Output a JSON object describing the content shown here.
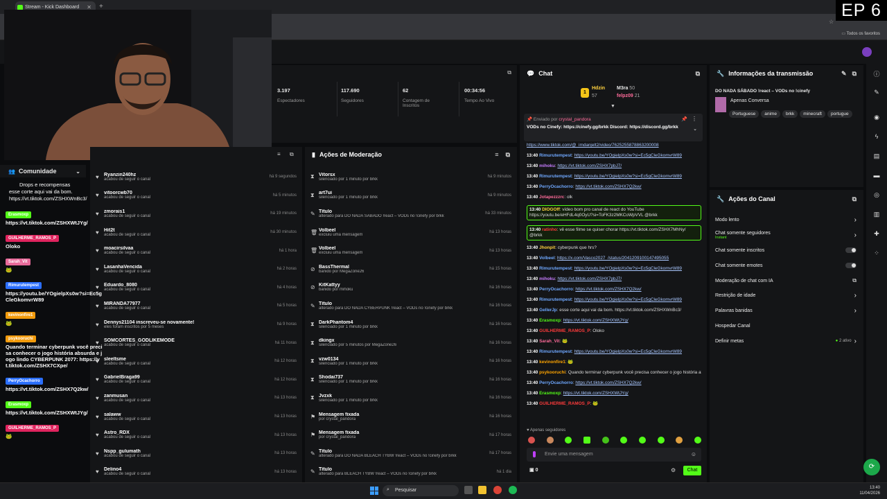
{
  "browser": {
    "tab_title": "Stream - Kick Dashboard",
    "tab_close": "✕",
    "new_tab": "+",
    "bookmarks_folder": "Todos os favoritos"
  },
  "overlay_label": "EP 6",
  "stats": [
    {
      "value": "3.197",
      "label": "Espectadores"
    },
    {
      "value": "117.690",
      "label": "Seguidores"
    },
    {
      "value": "62",
      "label": "Contagem de Inscritos"
    },
    {
      "value": "00:34:56",
      "label": "Tempo Ao Vivo"
    }
  ],
  "community": {
    "title": "Comunidade",
    "drops_text": "Drops e recompensas",
    "items": [
      {
        "name": "Ryanzin240hz",
        "action": "acabou de seguir o canal",
        "time": "há 9 segundos"
      },
      {
        "name": "vitoorcwb70",
        "action": "acabou de seguir o canal",
        "time": "há 5 minutos"
      },
      {
        "name": "zmorais1",
        "action": "acabou de seguir o canal",
        "time": "há 19 minutos"
      },
      {
        "name": "Hit2t",
        "action": "acabou de seguir o canal",
        "time": "há 30 minutos"
      },
      {
        "name": "moacirsilvaa",
        "action": "acabou de seguir o canal",
        "time": "há 1 hora"
      },
      {
        "name": "LasanhaVencida",
        "action": "acabou de seguir o canal",
        "time": "há 2 horas"
      },
      {
        "name": "Eduardo_8080",
        "action": "acabou de seguir o canal",
        "time": "há 4 horas"
      },
      {
        "name": "MIRANDA77977",
        "action": "acabou de seguir o canal",
        "time": "há 5 horas"
      },
      {
        "name": "Dennys21104 inscreveu-se novamente!",
        "action": "eles foram inscritos por 5 meses",
        "time": "há 9 horas"
      },
      {
        "name": "SOMCORTES_GODLIKEMODE",
        "action": "acabou de seguir o canal",
        "time": "há 11 horas"
      },
      {
        "name": "sleeltsme",
        "action": "acabou de seguir o canal",
        "time": "há 12 horas"
      },
      {
        "name": "GabrielBraga99",
        "action": "acabou de seguir o canal",
        "time": "há 12 horas"
      },
      {
        "name": "zanmusan",
        "action": "acabou de seguir o canal",
        "time": "há 13 horas"
      },
      {
        "name": "salaww",
        "action": "acabou de seguir o canal",
        "time": "há 13 horas"
      },
      {
        "name": "Astro_RDX",
        "action": "acabou de seguir o canal",
        "time": "há 13 horas"
      },
      {
        "name": "Nspp_gulumath",
        "action": "acabou de seguir o canal",
        "time": "há 13 horas"
      },
      {
        "name": "Delino4",
        "action": "acabou de seguir o canal",
        "time": "há 13 horas"
      }
    ]
  },
  "moderation": {
    "title": "Ações de Moderação",
    "items": [
      {
        "icon": "⧗",
        "name": "Vitorsx",
        "detail": "silenciado por 1 minuto por brkk",
        "time": "há 9 minutos"
      },
      {
        "icon": "⧗",
        "name": "art7ui",
        "detail": "silenciado por 1 minuto por brkk",
        "time": "há 9 minutos"
      },
      {
        "icon": "✎",
        "name": "Título",
        "detail": "alterado para DO NADA SÁBADO !react – VODs no !cinefy por brkk",
        "time": "há 33 minutos"
      },
      {
        "icon": "🗑",
        "name": "Volbeel",
        "detail": "excluiu uma mensagem",
        "time": "há 13 horas"
      },
      {
        "icon": "🗑",
        "name": "Volbeel",
        "detail": "excluiu uma mensagem",
        "time": "há 13 horas"
      },
      {
        "icon": "⊘",
        "name": "BassThermal",
        "detail": "banido por MegaZone26",
        "time": "há 15 horas"
      },
      {
        "icon": "⊘",
        "name": "KitKattyy",
        "detail": "banido por mihoku",
        "time": "há 16 horas"
      },
      {
        "icon": "✎",
        "name": "Título",
        "detail": "alterado para DO NADA CYBERPUNK !react – VODs no !cinefy por brkk",
        "time": "há 16 horas"
      },
      {
        "icon": "⧗",
        "name": "DarkPhantom4",
        "detail": "silenciado por 1 minuto por brkk",
        "time": "há 16 horas"
      },
      {
        "icon": "⧗",
        "name": "dkingx",
        "detail": "silenciado por 5 minutos por MegaZone26",
        "time": "há 16 horas"
      },
      {
        "icon": "⧗",
        "name": "vzw0134",
        "detail": "silenciado por 1 minuto por brkk",
        "time": "há 16 horas"
      },
      {
        "icon": "⧗",
        "name": "Shodai737",
        "detail": "silenciado por 1 minuto por brkk",
        "time": "há 16 horas"
      },
      {
        "icon": "⧗",
        "name": "Jvzxk",
        "detail": "silenciado por 1 minuto por brkk",
        "time": "há 16 horas"
      },
      {
        "icon": "⚑",
        "name": "Mensagem fixada",
        "detail": "por crystal_pandora",
        "time": "há 16 horas"
      },
      {
        "icon": "⚑",
        "name": "Mensagem fixada",
        "detail": "por crystal_pandora",
        "time": "há 17 horas"
      },
      {
        "icon": "✎",
        "name": "Título",
        "detail": "alterado para DO NADA BLEACH TYBW !react – VODs no !cinefy por brkk",
        "time": "há 17 horas"
      },
      {
        "icon": "✎",
        "name": "Título",
        "detail": "alterado para BLEACH TYBW !react – VODs no !cinefy por brkk",
        "time": "há 1 dia"
      }
    ]
  },
  "chat": {
    "title": "Chat",
    "leaders": [
      {
        "name": "Hdzin",
        "count": "57"
      },
      {
        "name": "M3ra",
        "count": "50"
      },
      {
        "name": "felpz09",
        "count": "21"
      }
    ],
    "pinned_by_label": "Enviado por",
    "pinned_user": "crystal_pandora",
    "pinned_text": "VODs no Cinefy: https://cinefy.gg/brkk Discord: https://discord.gg/brkk",
    "messages": [
      {
        "time": "",
        "user": "",
        "color": "#ddd",
        "text": "https://www.tiktok.com/@_imdanjelt2/video/7625255878863200008",
        "link": true
      },
      {
        "time": "13:40",
        "user": "Rimurutempest",
        "color": "#6fa8ff",
        "text": "https://youtu.be/YOgielpXs0w?si=Ec5gCleGkomvrW89",
        "link": true
      },
      {
        "time": "13:40",
        "user": "mihoku",
        "color": "#c77dff",
        "text": "https://vt.tiktok.com/ZSHX7pbJ7/",
        "link": true
      },
      {
        "time": "13:40",
        "user": "Rimurutempest",
        "color": "#6fa8ff",
        "text": "https://youtu.be/YOgielpXs0w?si=Ec5gCleGkomvrW89",
        "link": true
      },
      {
        "time": "13:40",
        "user": "PerryOcachorro",
        "color": "#6fa8ff",
        "text": "https://vt.tiktok.com/ZSHX7Q2kw/",
        "link": true
      },
      {
        "time": "13:40",
        "user": "Jotapezzzrc",
        "color": "#ff6b9a",
        "text": "olk",
        "link": false
      },
      {
        "time": "13:40",
        "user": "DIOGOff",
        "color": "#ffd23f",
        "text": "vídeo bom pro canal de react do YouTube https://youtu.be/eHFdL4q0OyU?si=ToFK3z2MKCoWpVVL @brkk",
        "link": false,
        "hl": true
      },
      {
        "time": "13:40",
        "user": "ratinho",
        "color": "#ff3b3b",
        "text": "vê esse filme se quiser chorar https://vt.tiktok.com/ZSHX7MhNy/ @brkk",
        "link": false,
        "hl": true
      },
      {
        "time": "13:40",
        "user": "Jhonpit",
        "color": "#ffd23f",
        "text": "cyberpunk que hrs?",
        "link": false
      },
      {
        "time": "13:40",
        "user": "Volbeel",
        "color": "#6fa8ff",
        "text": "https://x.com/Vasco2027_/status/2041209100147495055",
        "link": true
      },
      {
        "time": "13:40",
        "user": "Rimurutempest",
        "color": "#6fa8ff",
        "text": "https://youtu.be/YOgielpXs0w?si=Ec5gCleGkomvrW89",
        "link": true
      },
      {
        "time": "13:40",
        "user": "mihoku",
        "color": "#c77dff",
        "text": "https://vt.tiktok.com/ZSHX7pbJ7/",
        "link": true
      },
      {
        "time": "13:40",
        "user": "PerryOcachorro",
        "color": "#6fa8ff",
        "text": "https://vt.tiktok.com/ZSHX7Q2kw/",
        "link": true
      },
      {
        "time": "13:40",
        "user": "Rimurutempest",
        "color": "#6fa8ff",
        "text": "https://youtu.be/YOgielpXs0w?si=Ec5gCleGkomvrW89",
        "link": true
      },
      {
        "time": "13:40",
        "user": "GellerJp",
        "color": "#6fa8ff",
        "text": "esse corte aqui vai da bom. https://vt.tiktok.com/ZSHXWnBc3/",
        "link": false
      },
      {
        "time": "13:40",
        "user": "Erasmoxp",
        "color": "#53fc18",
        "text": "https://vt.tiktok.com/ZSHXWtJYg/",
        "link": true
      },
      {
        "time": "13:40",
        "user": "GUILHERME_RAMOS_P",
        "color": "#ff3b3b",
        "text": "Oloko",
        "link": false
      },
      {
        "time": "13:40",
        "user": "Sarah_Vit",
        "color": "#ff6b9a",
        "text": "🐸",
        "link": false
      },
      {
        "time": "13:40",
        "user": "Rimurutempest",
        "color": "#6fa8ff",
        "text": "https://youtu.be/YOgielpXs0w?si=Ec5gCleGkomvrW89",
        "link": true
      },
      {
        "time": "13:40",
        "user": "kevinonfire1",
        "color": "#ffa500",
        "text": "🐸",
        "link": false
      },
      {
        "time": "13:40",
        "user": "psykooruchi",
        "color": "#ffa500",
        "text": "Quando terminar cyberpunk você precisa conhecer o jogo história absurda e jogo lindo CYBERPUNK 2077: https://vt.tiktok.com/ZSHX7CXpe/",
        "link": false
      },
      {
        "time": "13:40",
        "user": "PerryOcachorro",
        "color": "#6fa8ff",
        "text": "https://vt.tiktok.com/ZSHX7Q2kw/",
        "link": true
      },
      {
        "time": "13:40",
        "user": "Erasmoxp",
        "color": "#53fc18",
        "text": "https://vt.tiktok.com/ZSHXWtJYg/",
        "link": true
      },
      {
        "time": "13:40",
        "user": "GUILHERME_RAMOS_P",
        "color": "#ff3b3b",
        "text": "🐸",
        "link": false
      }
    ],
    "followers_only": "Apenas seguidores",
    "input_placeholder": "Envie uma mensagem",
    "counter": "0",
    "send_label": "Chat"
  },
  "stream_info": {
    "title": "Informações da transmissão",
    "stream_title": "DO NADA SÁBADO !react – VODs no !cinefy",
    "category": "Apenas Conversa",
    "tags": [
      "Portuguese",
      "anime",
      "brkk",
      "minecraft",
      "portugue"
    ]
  },
  "channel_actions": {
    "title": "Ações do Canal",
    "items": [
      {
        "label": "Modo lento",
        "control": "chevron"
      },
      {
        "label": "Chat somente seguidores",
        "sub": "Instant",
        "control": "chevron"
      },
      {
        "label": "Chat somente inscritos",
        "control": "toggle"
      },
      {
        "label": "Chat somente emotes",
        "control": "toggle"
      },
      {
        "label": "Moderação de chat com IA",
        "control": "external"
      },
      {
        "label": "Restrição de idade",
        "control": "chevron"
      },
      {
        "label": "Palavras banidas",
        "control": "chevron"
      },
      {
        "label": "Hospedar Canal",
        "control": "none"
      },
      {
        "label": "Definir metas",
        "extra": "2 ativo",
        "control": "chevron"
      }
    ]
  },
  "left_overlay": {
    "drops_caption": "Drops e recompensas",
    "top_lines": [
      "esse corte aqui vai da bom.",
      "https://vt.tiktok.com/ZSHXWnBc3/"
    ],
    "messages": [
      {
        "name": "Erasmoxp",
        "color": "#53fc18",
        "msg": "https://vt.tiktok.com/ZSHXWtJYg/"
      },
      {
        "name": "GUILHERME_RAMOS_P",
        "color": "#e0245e",
        "msg": "Oloko"
      },
      {
        "name": "Sarah_Vit",
        "color": "#e86a9a",
        "msg": "🐸"
      },
      {
        "name": "Rimurutempest",
        "color": "#2b6fff",
        "msg": "https://youtu.be/YOgielpXs0w?si=Ec5gCleGkomvrW89"
      },
      {
        "name": "kevinonfire1",
        "color": "#f29b0c",
        "msg": "🐸"
      },
      {
        "name": "psykooruchi",
        "color": "#f29b0c",
        "msg": "Quando terminar cyberpunk você precisa conhecer o jogo história absurda e jogo lindo CYBERPUNK 2077: https://vt.tiktok.com/ZSHX7CXpe/"
      },
      {
        "name": "PerryOcachorro",
        "color": "#2b6fff",
        "msg": "https://vt.tiktok.com/ZSHX7Q2kw/"
      },
      {
        "name": "Erasmoxp",
        "color": "#53fc18",
        "msg": "https://vt.tiktok.com/ZSHXWtJYg/"
      },
      {
        "name": "GUILHERME_RAMOS_P",
        "color": "#e0245e",
        "msg": "🐸"
      }
    ]
  },
  "taskbar": {
    "search_label": "Pesquisar",
    "time": "13:40",
    "date": "11/04/2026"
  },
  "colors": {
    "accent": "#53fc18",
    "panel": "#141517",
    "bg": "#0b0c0e"
  }
}
